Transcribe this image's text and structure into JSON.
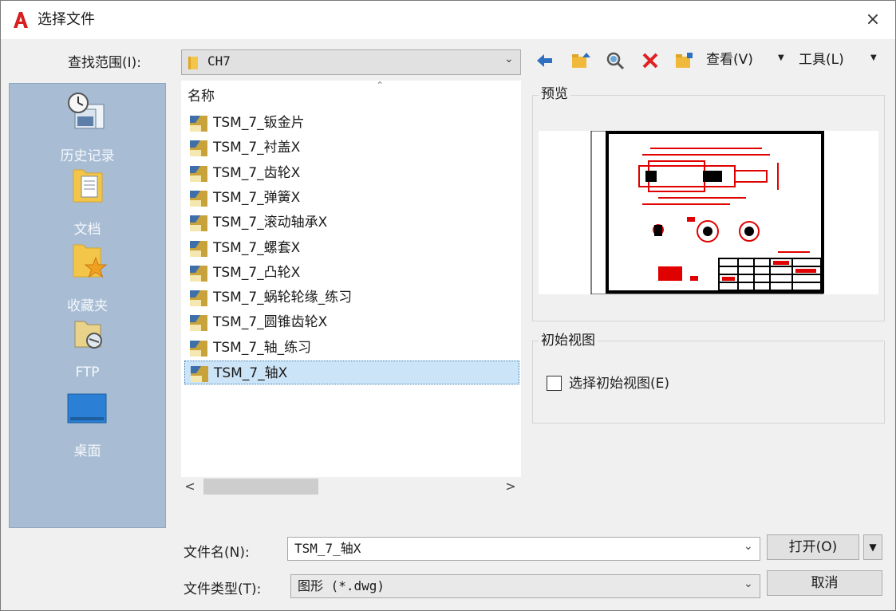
{
  "window": {
    "title": "选择文件",
    "close_label": "×"
  },
  "lookin": {
    "label": "查找范围(I):",
    "value": "CH7"
  },
  "toolbar": {
    "icons": [
      "back-arrow-icon",
      "up-folder-icon",
      "search-web-icon",
      "delete-icon",
      "create-folder-icon"
    ],
    "view_label": "查看(V)",
    "tools_label": "工具(L)"
  },
  "places": [
    {
      "label": "历史记录",
      "icon": "history-icon"
    },
    {
      "label": "文档",
      "icon": "documents-icon"
    },
    {
      "label": "收藏夹",
      "icon": "favorites-icon"
    },
    {
      "label": "FTP",
      "icon": "ftp-icon"
    },
    {
      "label": "桌面",
      "icon": "desktop-icon"
    }
  ],
  "filelist": {
    "header": "名称",
    "files": [
      "TSM_7_钣金片",
      "TSM_7_衬盖X",
      "TSM_7_齿轮X",
      "TSM_7_弹簧X",
      "TSM_7_滚动轴承X",
      "TSM_7_螺套X",
      "TSM_7_凸轮X",
      "TSM_7_蜗轮轮缘_练习",
      "TSM_7_圆锥齿轮X",
      "TSM_7_轴_练习",
      "TSM_7_轴X"
    ],
    "selected_index": 10
  },
  "scroll": {
    "left": "<",
    "right": ">"
  },
  "preview": {
    "title": "预览"
  },
  "initial_view": {
    "title": "初始视图",
    "checkbox_label": "选择初始视图(E)",
    "checked": false
  },
  "filename": {
    "label": "文件名(N):",
    "value": "TSM_7_轴X"
  },
  "filetype": {
    "label": "文件类型(T):",
    "value": "图形 (*.dwg)"
  },
  "buttons": {
    "open": "打开(O)",
    "cancel": "取消"
  },
  "colors": {
    "places_bg": "#a8bdd4",
    "selection": "#cce4f7",
    "drawing_red": "#e00000",
    "app_icon_red": "#d81e1e"
  }
}
